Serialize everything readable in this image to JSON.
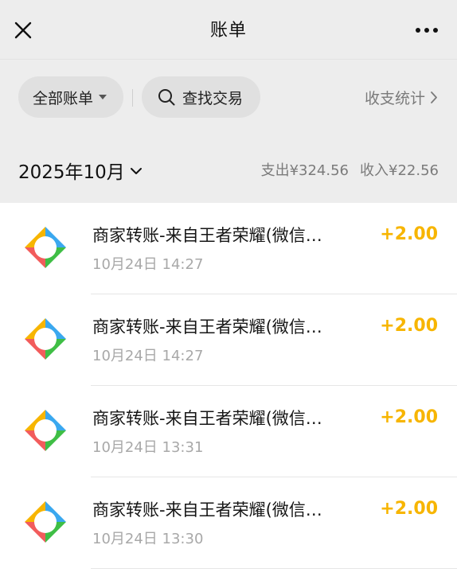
{
  "nav": {
    "title": "账单",
    "close_icon": "close-icon",
    "more_icon": "more-icon"
  },
  "filters": {
    "all_bills_label": "全部账单",
    "search_label": "查找交易",
    "stats_label": "收支统计"
  },
  "month": {
    "label": "2025年10月",
    "expense": "支出¥324.56",
    "income": "收入¥22.56"
  },
  "colors": {
    "amount": "#f7b500",
    "background": "#ededed",
    "logo_blue": "#3aa8ef",
    "logo_yellow": "#f7b500",
    "logo_red": "#f25c5c",
    "logo_green": "#3fbe45"
  },
  "transactions": [
    {
      "title": "商家转账-来自王者荣耀(微信…",
      "time": "10月24日 14:27",
      "amount": "+2.00",
      "icon": "merchant-transfer-logo-icon"
    },
    {
      "title": "商家转账-来自王者荣耀(微信…",
      "time": "10月24日 14:27",
      "amount": "+2.00",
      "icon": "merchant-transfer-logo-icon"
    },
    {
      "title": "商家转账-来自王者荣耀(微信…",
      "time": "10月24日 13:31",
      "amount": "+2.00",
      "icon": "merchant-transfer-logo-icon"
    },
    {
      "title": "商家转账-来自王者荣耀(微信…",
      "time": "10月24日 13:30",
      "amount": "+2.00",
      "icon": "merchant-transfer-logo-icon"
    }
  ]
}
